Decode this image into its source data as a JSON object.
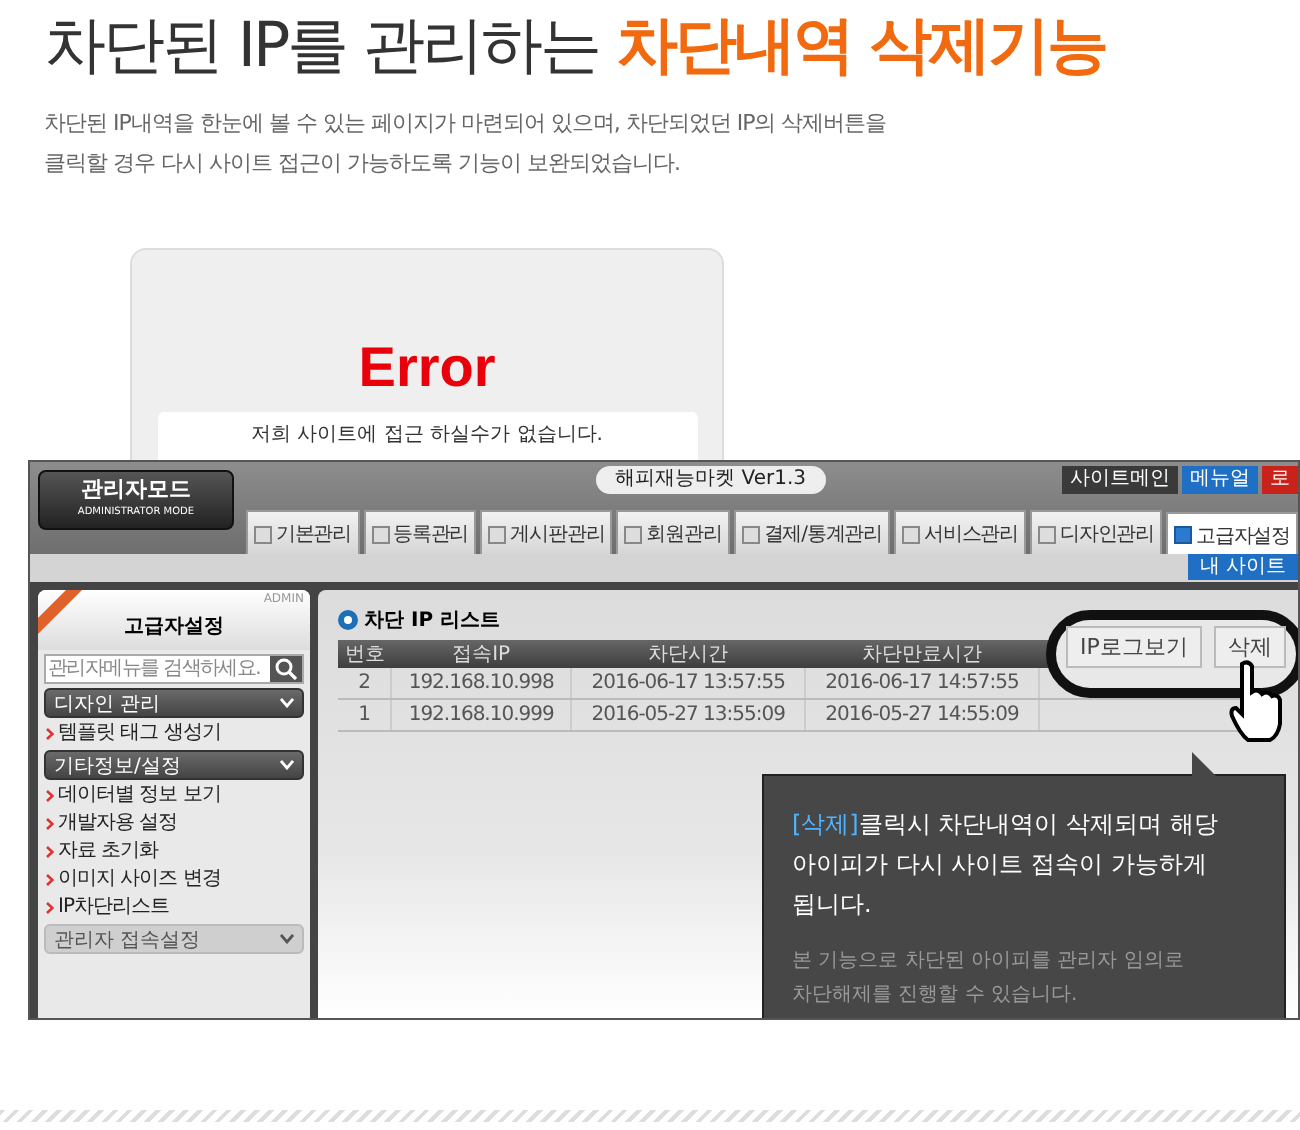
{
  "headline": {
    "text": "차단된 IP를 관리하는",
    "highlight": "차단내역 삭제기능"
  },
  "description": [
    "차단된 IP내역을 한눈에 볼 수 있는 페이지가 마련되어 있으며, 차단되었던 IP의 삭제버튼을",
    "클릭할 경우 다시 사이트 접근이 가능하도록 기능이 보완되었습니다."
  ],
  "error_page": {
    "title": "Error",
    "message": "저희 사이트에 접근 하실수가 없습니다."
  },
  "admin": {
    "logo": {
      "title": "관리자모드",
      "subtitle": "ADMINISTRATOR MODE"
    },
    "site_title": "해피재능마켓 Ver1.3",
    "top_buttons": [
      {
        "label": "사이트메인",
        "color": "#3a3a3a"
      },
      {
        "label": "메뉴얼",
        "color": "#1f6fc4"
      },
      {
        "label": "로",
        "color": "#c9221b"
      }
    ],
    "tabs": [
      {
        "label": "기본관리",
        "selected": false
      },
      {
        "label": "등록관리",
        "selected": false
      },
      {
        "label": "게시판관리",
        "selected": false
      },
      {
        "label": "회원관리",
        "selected": false
      },
      {
        "label": "결제/통계관리",
        "selected": false
      },
      {
        "label": "서비스관리",
        "selected": false
      },
      {
        "label": "디자인관리",
        "selected": false
      },
      {
        "label": "고급자설정",
        "selected": true
      }
    ],
    "sub_button": "내 사이트",
    "sidebar": {
      "badge": "ADMIN",
      "title": "고급자설정",
      "search_placeholder": "관리자메뉴를 검색하세요.",
      "sections": [
        {
          "label": "디자인 관리",
          "disabled": false,
          "items": [
            "템플릿 태그 생성기"
          ]
        },
        {
          "label": "기타정보/설정",
          "disabled": false,
          "items": [
            "데이터별 정보 보기",
            "개발자용 설정",
            "자료 초기화",
            "이미지 사이즈 변경",
            "IP차단리스트"
          ]
        },
        {
          "label": "관리자 접속설정",
          "disabled": true
        }
      ]
    },
    "content": {
      "title": "차단 IP 리스트",
      "columns": [
        "번호",
        "접속IP",
        "차단시간",
        "차단만료시간"
      ],
      "rows": [
        [
          "2",
          "192.168.10.998",
          "2016-06-17 13:57:55",
          "2016-06-17 14:57:55"
        ],
        [
          "1",
          "192.168.10.999",
          "2016-05-27 13:55:09",
          "2016-05-27 14:55:09"
        ]
      ]
    },
    "callout": {
      "buttons": [
        "IP로그보기",
        "삭제"
      ]
    },
    "tooltip": {
      "lead": "[삭제]",
      "text": "클릭시 차단내역이 삭제되며 해당 아이피가 다시 사이트 접속이 가능하게 됩니다.",
      "note": "본 기능으로 차단된 아이피를 관리자 임의로 차단해제를 진행할 수 있습니다."
    }
  }
}
